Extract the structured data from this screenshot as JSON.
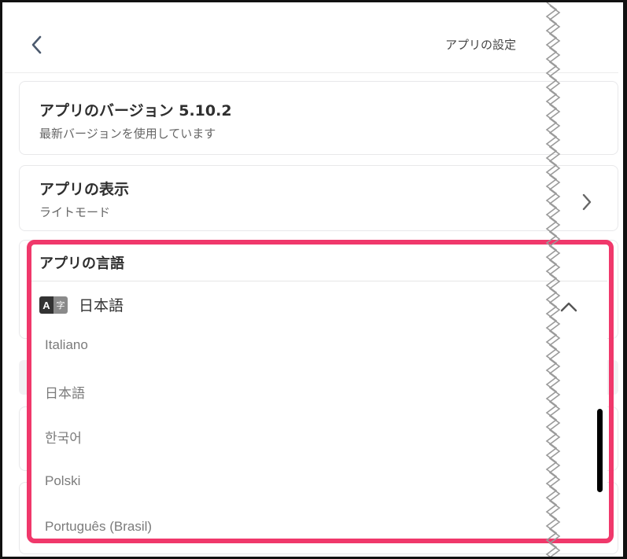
{
  "header": {
    "title": "アプリの設定"
  },
  "version_card": {
    "heading": "アプリのバージョン 5.10.2",
    "subtext": "最新バージョンを使用しています"
  },
  "display_card": {
    "heading": "アプリの表示",
    "subtext": "ライトモード"
  },
  "language": {
    "heading": "アプリの言語",
    "icon_letter_a": "A",
    "icon_letter_ji": "字",
    "selected": "日本語",
    "options": [
      "Italiano",
      "日本語",
      "한국어",
      "Polski",
      "Português (Brasil)"
    ]
  },
  "icons": {
    "back": "chevron-left-icon",
    "display_chevron": "chevron-right-icon",
    "dropdown": "chevron-up-icon",
    "language": "language-icon"
  },
  "colors": {
    "highlight": "#f0386b"
  }
}
